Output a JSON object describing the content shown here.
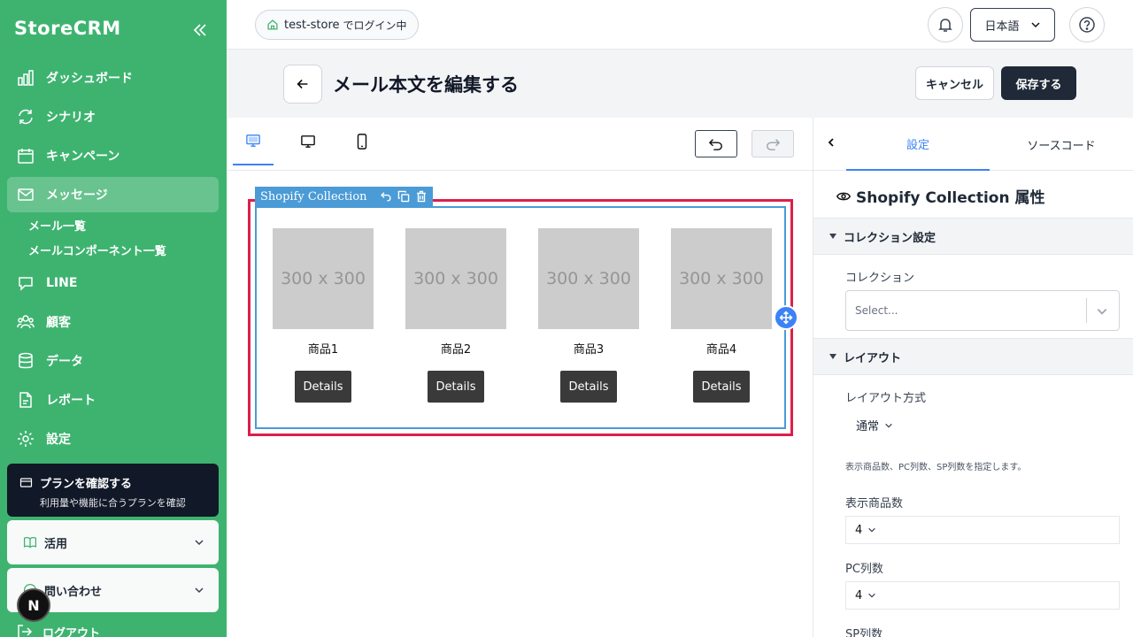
{
  "sidebar": {
    "brand": "StoreCRM",
    "items": [
      {
        "label": "ダッシュボード"
      },
      {
        "label": "シナリオ"
      },
      {
        "label": "キャンペーン"
      },
      {
        "label": "メッセージ"
      },
      {
        "label": "LINE"
      },
      {
        "label": "顧客"
      },
      {
        "label": "データ"
      },
      {
        "label": "レポート"
      },
      {
        "label": "設定"
      }
    ],
    "sub_items": [
      "メール一覧",
      "メールコンポーネント一覧"
    ],
    "plan": {
      "title": "プランを確認する",
      "subtitle": "利用量や機能に合うプランを確認"
    },
    "cards": [
      "活用",
      "問い合わせ"
    ],
    "logout": "ログアウト",
    "avatar_letter": "N"
  },
  "topbar": {
    "store_name": "test-store",
    "store_suffix": "でログイン中",
    "language": "日本語"
  },
  "header": {
    "title": "メール本文を編集する",
    "cancel": "キャンセル",
    "save": "保存する"
  },
  "editor": {
    "component_label": "Shopify Collection",
    "products": [
      {
        "placeholder": "300 x 300",
        "name": "商品1",
        "button": "Details"
      },
      {
        "placeholder": "300 x 300",
        "name": "商品2",
        "button": "Details"
      },
      {
        "placeholder": "300 x 300",
        "name": "商品3",
        "button": "Details"
      },
      {
        "placeholder": "300 x 300",
        "name": "商品4",
        "button": "Details"
      }
    ]
  },
  "panel": {
    "tabs": [
      "設定",
      "ソースコード"
    ],
    "title": "Shopify Collection 属性",
    "section_collection": "コレクション設定",
    "collection_label": "コレクション",
    "collection_placeholder": "Select...",
    "section_layout": "レイアウト",
    "layout_method_label": "レイアウト方式",
    "layout_method_value": "通常",
    "hint": "表示商品数、PC列数、SP列数を指定します。",
    "display_count_label": "表示商品数",
    "display_count_value": "4",
    "pc_cols_label": "PC列数",
    "pc_cols_value": "4",
    "sp_cols_label": "SP列数"
  },
  "colors": {
    "sidebar": "#3eb370",
    "accent": "#3b82f6",
    "selection": "#dc1f4a",
    "dark": "#1f2937"
  }
}
